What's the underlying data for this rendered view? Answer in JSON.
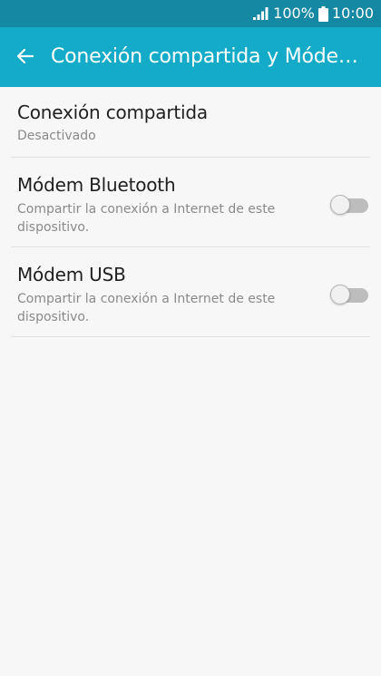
{
  "status_bar": {
    "battery_percent": "100%",
    "time": "10:00",
    "icons": [
      "signal-icon",
      "battery-icon"
    ]
  },
  "app_bar": {
    "title": "Conexión compartida y Módem USB",
    "back_icon": "arrow-left-icon"
  },
  "settings": [
    {
      "title": "Conexión compartida",
      "subtitle": "Desactivado"
    },
    {
      "title": "Módem Bluetooth",
      "subtitle": "Compartir la conexión a Internet de este dispositivo.",
      "toggle_on": false
    },
    {
      "title": "Módem USB",
      "subtitle": "Compartir la conexión a Internet de este dispositivo.",
      "toggle_on": false
    }
  ],
  "colors": {
    "status_bar": "#1588a3",
    "app_bar": "#14abc9",
    "background": "#f7f7f7",
    "title_text": "#1f1f1f",
    "subtitle_text": "#8a8a8a",
    "toggle_off_track": "#bdbdbd"
  }
}
